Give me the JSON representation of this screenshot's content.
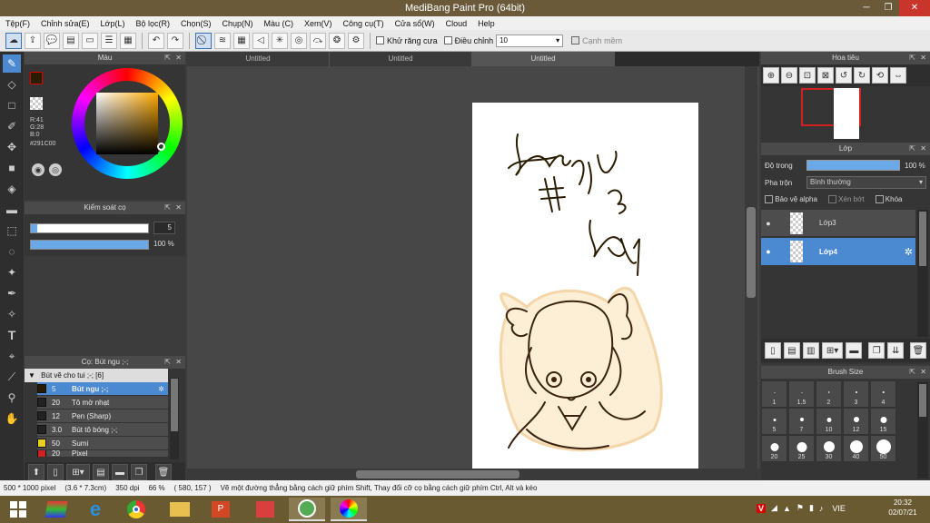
{
  "window": {
    "title": "MediBang Paint Pro (64bit)"
  },
  "menu": [
    "Tệp(F)",
    "Chỉnh sửa(E)",
    "Lớp(L)",
    "Bộ lọc(R)",
    "Chọn(S)",
    "Chụp(N)",
    "Màu (C)",
    "Xem(V)",
    "Công cụ(T)",
    "Cửa sổ(W)",
    "Cloud",
    "Help"
  ],
  "toolbar": {
    "antialias_label": "Khử răng cưa",
    "correction_label": "Điều chỉnh",
    "correction_value": "10",
    "soft_edge_label": "Cạnh mềm"
  },
  "color_panel": {
    "title": "Màu",
    "r": "R:41",
    "g": "G:28",
    "b": "B:0",
    "hex": "#291C00",
    "primary_color": "#291C00"
  },
  "brush_control": {
    "title": "Kiểm soát cọ",
    "size": "5",
    "opacity": "100 %"
  },
  "brush_panel": {
    "title": "Cọ: Bút ngu ;-;",
    "group": "Bút vẽ cho tui ;-; [6]",
    "items": [
      {
        "size": "5",
        "name": "Bút ngu ;-;",
        "color": "#291C00"
      },
      {
        "size": "20",
        "name": "Tô mờ nhạt",
        "color": "#222222"
      },
      {
        "size": "12",
        "name": "Pen (Sharp)",
        "color": "#222222"
      },
      {
        "size": "3.0",
        "name": "Bút tô bóng ;-;",
        "color": "#222222"
      },
      {
        "size": "50",
        "name": "Sumi",
        "color": "#e8d020"
      },
      {
        "size": "20",
        "name": "Pixel",
        "color": "#d02020"
      }
    ]
  },
  "tabs": [
    "Untitled",
    "Untitled",
    "Untitled"
  ],
  "navigator": {
    "title": "Hoa tiêu"
  },
  "layer_panel": {
    "title": "Lớp",
    "opacity_label": "Độ trong",
    "opacity_value": "100 %",
    "blend_label": "Pha trộn",
    "blend_value": "Bình thường",
    "protect_alpha": "Bảo vệ alpha",
    "clipping": "Xén bớt",
    "lock": "Khóa",
    "layers": [
      {
        "name": "Lớp3",
        "selected": false
      },
      {
        "name": "Lớp4",
        "selected": true
      }
    ]
  },
  "brush_size_panel": {
    "title": "Brush Size",
    "sizes": [
      "1",
      "1.5",
      "2",
      "3",
      "4",
      "5",
      "7",
      "10",
      "12",
      "15",
      "20",
      "25",
      "30",
      "40",
      "50"
    ]
  },
  "status": {
    "canvas_size": "500 * 1000 pixel",
    "physical": "(3.6 * 7.3cm)",
    "dpi": "350 dpi",
    "zoom": "66 %",
    "cursor": "( 580, 157 )",
    "hint": "Vẽ một đường thẳng bằng cách giữ phím Shift, Thay đổi cỡ cọ bằng cách giữ phím Ctrl, Alt và kéo"
  },
  "taskbar": {
    "lang": "VIE",
    "time": "20:32",
    "date": "02/07/21"
  }
}
